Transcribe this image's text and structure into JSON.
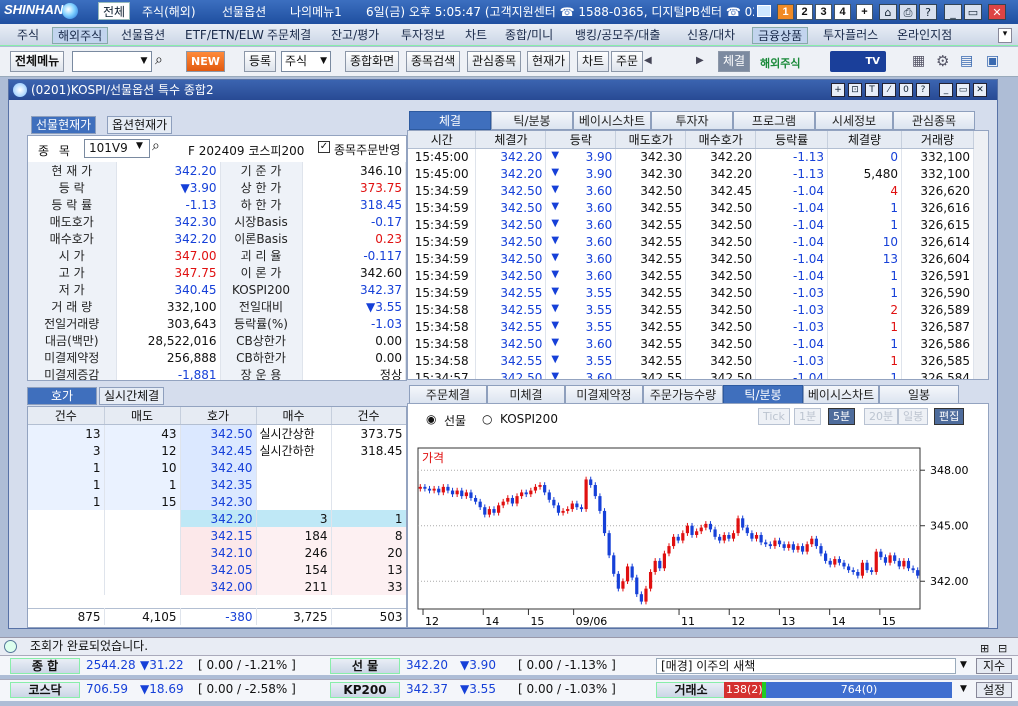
{
  "topbar": {
    "logo": "SHINHAN",
    "menus": [
      "전체",
      "주식(해외)",
      "선물옵션",
      "나의메뉴1"
    ],
    "info": "6일(금) 오후 5:05:47 (고객지원센터 ☎ 1588-0365, 디지털PB센터 ☎ 02",
    "workspaces": [
      "1",
      "2",
      "3",
      "4"
    ],
    "buttons": [
      "+",
      "⌂",
      "⎙",
      "?",
      "_",
      "▭",
      "✕"
    ]
  },
  "menubar": [
    "주식",
    "해외주식",
    "선물옵션",
    "ETF/ETN/ELW",
    "주문체결",
    "잔고/평가",
    "투자정보",
    "차트",
    "종합/미니",
    "뱅킹/공모주/대출",
    "신용/대차",
    "금융상품",
    "투자플러스",
    "온라인지점"
  ],
  "toolbar": {
    "all_menu": "전체메뉴",
    "new": "NEW",
    "register": "등록",
    "stock": "주식",
    "buttons": [
      "종합화면",
      "종목검색",
      "관심종목",
      "현재가",
      "차트",
      "주문"
    ],
    "execution": "체결",
    "overseas": "해외주식",
    "tv": "TV"
  },
  "window": {
    "title": "(0201)KOSPI/선물옵션 특수 종합2",
    "buttons": [
      "+",
      "⊡",
      "T",
      "⁄",
      "0",
      "?",
      "_",
      "▭",
      "✕"
    ]
  },
  "left": {
    "tabs": [
      "선물현재가",
      "옵션현재가"
    ],
    "code_label": "종 목",
    "code": "101V9",
    "name": "F 202409 코스피200",
    "checkbox_label": "종목주문반영",
    "rows": [
      [
        "현 재 가",
        "342.20",
        "blue",
        "기 준 가",
        "346.10",
        "dk"
      ],
      [
        "등 락",
        "▼3.90",
        "blue",
        "상 한 가",
        "373.75",
        "red"
      ],
      [
        "등 락 률",
        "-1.13",
        "blue",
        "하 한 가",
        "318.45",
        "blue"
      ],
      [
        "매도호가",
        "342.30",
        "blue",
        "시장Basis",
        "-0.17",
        "blue"
      ],
      [
        "매수호가",
        "342.20",
        "blue",
        "이론Basis",
        "0.23",
        "red"
      ],
      [
        "시 가",
        "347.00",
        "red",
        "괴 리 율",
        "-0.117",
        "blue"
      ],
      [
        "고 가",
        "347.75",
        "red",
        "이 론 가",
        "342.60",
        "dk"
      ],
      [
        "저 가",
        "340.45",
        "blue",
        "KOSPI200",
        "342.37",
        "blue"
      ],
      [
        "거 래 량",
        "332,100",
        "dk",
        "전일대비",
        "▼3.55",
        "blue"
      ],
      [
        "전일거래량",
        "303,643",
        "dk",
        "등락률(%)",
        "-1.03",
        "blue"
      ],
      [
        "대금(백만)",
        "28,522,016",
        "dk",
        "CB상한가",
        "0.00",
        "dk"
      ],
      [
        "미결제약정",
        "256,888",
        "dk",
        "CB하한가",
        "0.00",
        "dk"
      ],
      [
        "미결제증감",
        "-1,881",
        "blue",
        "장 운 용",
        "정상",
        "dk"
      ]
    ]
  },
  "trades": {
    "tabs": [
      "체결",
      "틱/분봉",
      "베이시스차트",
      "투자자",
      "프로그램",
      "시세정보",
      "관심종목"
    ],
    "headers": [
      "시간",
      "체결가",
      "등락",
      "매도호가",
      "매수호가",
      "등락률",
      "체결량",
      "거래량"
    ],
    "rows": [
      [
        "15:45:00",
        "342.20",
        "3.90",
        "342.30",
        "342.20",
        "-1.13",
        "0",
        "332,100",
        "blue"
      ],
      [
        "15:45:00",
        "342.20",
        "3.90",
        "342.30",
        "342.20",
        "-1.13",
        "5,480",
        "332,100",
        "dk"
      ],
      [
        "15:34:59",
        "342.50",
        "3.60",
        "342.50",
        "342.45",
        "-1.04",
        "4",
        "326,620",
        "red"
      ],
      [
        "15:34:59",
        "342.50",
        "3.60",
        "342.55",
        "342.50",
        "-1.04",
        "1",
        "326,616",
        "blue"
      ],
      [
        "15:34:59",
        "342.50",
        "3.60",
        "342.55",
        "342.50",
        "-1.04",
        "1",
        "326,615",
        "blue"
      ],
      [
        "15:34:59",
        "342.50",
        "3.60",
        "342.55",
        "342.50",
        "-1.04",
        "10",
        "326,614",
        "blue"
      ],
      [
        "15:34:59",
        "342.50",
        "3.60",
        "342.55",
        "342.50",
        "-1.04",
        "13",
        "326,604",
        "blue"
      ],
      [
        "15:34:59",
        "342.50",
        "3.60",
        "342.55",
        "342.50",
        "-1.04",
        "1",
        "326,591",
        "blue"
      ],
      [
        "15:34:59",
        "342.55",
        "3.55",
        "342.55",
        "342.50",
        "-1.03",
        "1",
        "326,590",
        "blue"
      ],
      [
        "15:34:58",
        "342.55",
        "3.55",
        "342.55",
        "342.50",
        "-1.03",
        "2",
        "326,589",
        "red"
      ],
      [
        "15:34:58",
        "342.55",
        "3.55",
        "342.55",
        "342.50",
        "-1.03",
        "1",
        "326,587",
        "red"
      ],
      [
        "15:34:58",
        "342.50",
        "3.60",
        "342.55",
        "342.50",
        "-1.04",
        "1",
        "326,586",
        "blue"
      ],
      [
        "15:34:58",
        "342.55",
        "3.55",
        "342.55",
        "342.50",
        "-1.03",
        "1",
        "326,585",
        "red"
      ],
      [
        "15:34:57",
        "342.50",
        "3.60",
        "342.55",
        "342.50",
        "-1.04",
        "1",
        "326,584",
        "blue"
      ]
    ]
  },
  "orderbook": {
    "tabs": [
      "호가",
      "실시간체결"
    ],
    "headers": [
      "건수",
      "매도",
      "호가",
      "매수",
      "건수"
    ],
    "asks": [
      [
        "13",
        "43",
        "342.50"
      ],
      [
        "3",
        "12",
        "342.45"
      ],
      [
        "1",
        "10",
        "342.40"
      ],
      [
        "1",
        "1",
        "342.35"
      ],
      [
        "1",
        "15",
        "342.30"
      ]
    ],
    "bids": [
      [
        "342.20",
        "3",
        "1"
      ],
      [
        "342.15",
        "184",
        "8"
      ],
      [
        "342.10",
        "246",
        "20"
      ],
      [
        "342.05",
        "154",
        "13"
      ],
      [
        "342.00",
        "211",
        "33"
      ]
    ],
    "limit_up_label": "실시간상한",
    "limit_up": "373.75",
    "limit_down_label": "실시간하한",
    "limit_down": "318.45",
    "totals": [
      "875",
      "4,105",
      "-380",
      "3,725",
      "503"
    ]
  },
  "chartpanel": {
    "tabs": [
      "주문체결",
      "미체결",
      "미결제약정",
      "주문가능수량",
      "틱/분봉",
      "베이시스차트",
      "일봉"
    ],
    "radio": [
      "선물",
      "KOSPI200"
    ],
    "buttons": [
      "Tick",
      "1분",
      "5분",
      "20분",
      "일봉",
      "편집"
    ],
    "active_button": "5분"
  },
  "chart_data": {
    "type": "candlestick",
    "title": "가격",
    "ylim": [
      340.5,
      349.2
    ],
    "yticks": [
      "348.00",
      "345.00",
      "342.00"
    ],
    "xticks": [
      "12",
      "14",
      "15",
      "09/06",
      "11",
      "12",
      "13",
      "14",
      "15"
    ],
    "up_color": "#e01010",
    "down_color": "#1640d8",
    "close": [
      347.1,
      347.0,
      346.9,
      347.0,
      346.8,
      347.1,
      346.9,
      346.7,
      346.9,
      346.6,
      346.8,
      346.5,
      346.3,
      346.0,
      345.6,
      345.9,
      345.7,
      346.1,
      346.3,
      346.5,
      346.2,
      346.6,
      346.8,
      346.7,
      346.9,
      347.1,
      347.2,
      346.8,
      346.4,
      346.1,
      345.7,
      345.8,
      345.9,
      346.2,
      346.0,
      345.9,
      347.5,
      347.2,
      346.6,
      345.8,
      344.6,
      343.4,
      342.4,
      341.6,
      342.0,
      342.8,
      342.2,
      341.3,
      340.9,
      341.6,
      342.5,
      343.1,
      342.7,
      343.5,
      343.9,
      344.4,
      344.2,
      344.6,
      345.0,
      344.5,
      344.7,
      344.9,
      345.1,
      344.8,
      344.4,
      344.2,
      344.5,
      344.3,
      344.6,
      345.4,
      344.9,
      344.6,
      344.3,
      344.5,
      344.1,
      344.0,
      343.9,
      344.2,
      344.0,
      343.8,
      344.0,
      343.7,
      343.9,
      343.6,
      344.0,
      344.3,
      343.9,
      343.5,
      343.1,
      342.9,
      343.2,
      343.0,
      342.8,
      342.6,
      342.5,
      342.3,
      343.0,
      342.6,
      342.5,
      343.6,
      343.3,
      343.0,
      343.4,
      343.1,
      342.8,
      343.1,
      342.7,
      342.6,
      342.3
    ]
  },
  "status": {
    "message": "조회가 완료되었습니다."
  },
  "ticker1": {
    "name1": "종 합",
    "v1": "2544.28",
    "c1": "▼31.22",
    "p1": "[ 0.00 / -1.21% ]",
    "name2": "선 물",
    "v2": "342.20",
    "c2": "▼3.90",
    "p2": "[ 0.00 / -1.13% ]",
    "news": "[매경] 이주의 새책",
    "btn": "지수"
  },
  "ticker2": {
    "name1": "코스닥",
    "v1": "706.59",
    "c1": "▼18.69",
    "p1": "[ 0.00 / -2.58% ]",
    "name2": "KP200",
    "v2": "342.37",
    "c2": "▼3.55",
    "p2": "[ 0.00 / -1.03% ]",
    "exch": "거래소",
    "bar_left": "138(2)",
    "bar_right": "764(0)",
    "btn": "설정"
  }
}
